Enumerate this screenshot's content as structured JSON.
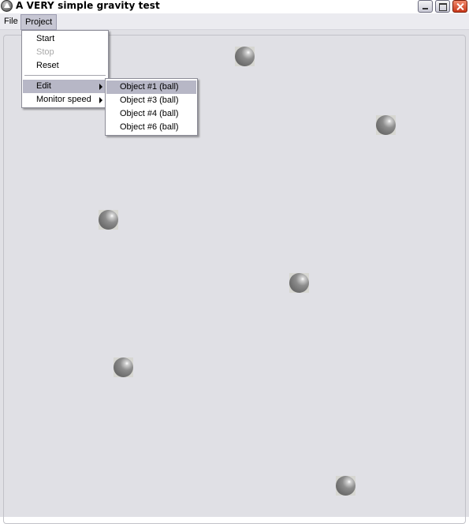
{
  "window": {
    "title": "A VERY simple gravity test",
    "controls": [
      "minimize-icon",
      "maximize-icon",
      "close-icon"
    ]
  },
  "menubar": {
    "items": [
      {
        "label": "File"
      },
      {
        "label": "Project",
        "open": true
      }
    ]
  },
  "project_menu": {
    "items": [
      {
        "label": "Start",
        "enabled": true
      },
      {
        "label": "Stop",
        "enabled": false
      },
      {
        "label": "Reset",
        "enabled": true
      },
      {
        "label": "Edit",
        "submenu": true,
        "highlighted": true
      },
      {
        "label": "Monitor speed",
        "submenu": true
      }
    ]
  },
  "edit_submenu": {
    "items": [
      {
        "label": "Object #1 (ball)",
        "highlighted": true
      },
      {
        "label": "Object #3 (ball)"
      },
      {
        "label": "Object #4 (ball)"
      },
      {
        "label": "Object #6 (ball)"
      }
    ]
  },
  "canvas": {
    "ball_count": 6
  },
  "colors": {
    "canvas_bg": "#e0e0e5",
    "menu_highlight": "#b7b7c6",
    "disabled_text": "#a9a9a9"
  }
}
